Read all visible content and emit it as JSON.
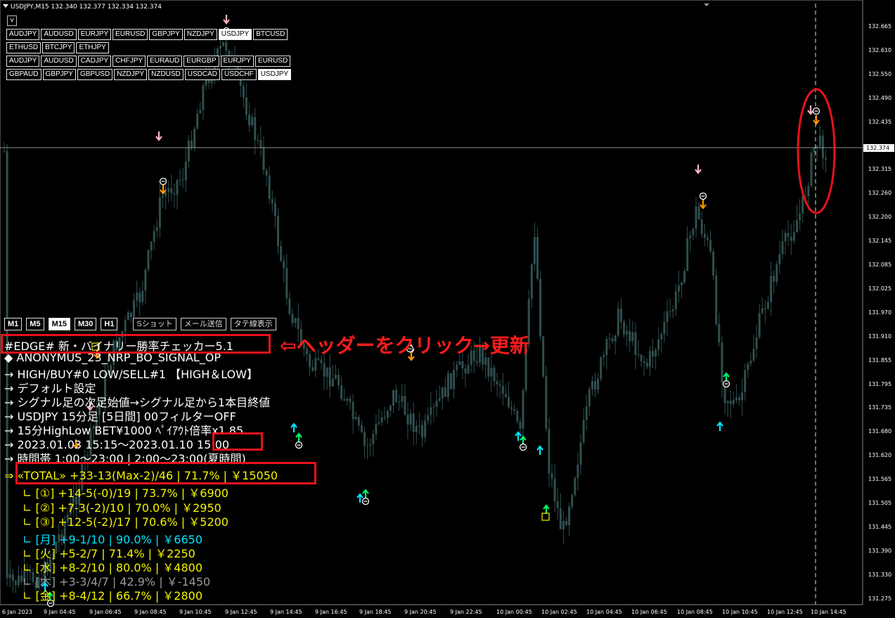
{
  "window": {
    "title": "USDJPY,M15  132.340 132.377 132.334 132.374",
    "v_label": "v"
  },
  "symbol_rows": [
    [
      "AUDJPY",
      "AUDUSD",
      "EURJPY",
      "EURUSD",
      "GBPJPY",
      "NZDJPY",
      "USDJPY",
      "BTCUSD"
    ],
    [
      "ETHUSD",
      "BTCJPY",
      "ETHJPY"
    ],
    [
      "AUDJPY",
      "AUDUSD",
      "CADJPY",
      "CHFJPY",
      "EURAUD",
      "EURGBP",
      "EURJPY",
      "EURUSD"
    ],
    [
      "GBPAUD",
      "GBPJPY",
      "GBPUSD",
      "NZDJPY",
      "NZDUSD",
      "USDCAD",
      "USDCHF",
      "USDJPY"
    ]
  ],
  "active_symbols": [
    [
      0,
      6
    ],
    [
      3,
      7
    ]
  ],
  "timeframes": [
    "M1",
    "M5",
    "M15",
    "M30",
    "H1"
  ],
  "active_timeframe": "M15",
  "tools": [
    "Sショット",
    "メール送信",
    "タテ線表示"
  ],
  "info": {
    "header": "#EDGE# 新・バイナリー勝率チェッカー5.1",
    "line1": "◆ ANONYMUS_23_NRP_BO_SIGNAL_OP",
    "line2": "→ HIGH/BUY#0  LOW/SELL#1   【HIGH＆LOW】",
    "line3": "→ デフォルト設定",
    "line4": "→ シグナル足の次足始値→シグナル足から1本目終値",
    "line5": "→ USDJPY    15分足   [5日間]   00フィルターOFF",
    "line6": "→ 15分HighLow   BET¥1000  ﾍﾟｲｱｳﾄ倍率x1.85",
    "line7": "→ 2023.01.03 15:15～2023.01.10 15:00",
    "line8": "→ 時間帯 1:00～23:00 | 2:00～23:00(夏時間)",
    "total": "⇒ «TOTAL» +33-13(Max-2)/46 | 71.7% | ￥15050",
    "sub1": "∟ [①] +14-5(-0)/19 | 73.7% | ￥6900",
    "sub2": "∟ [②] +7-3(-2)/10 | 70.0% | ￥2950",
    "sub3": "∟ [③] +12-5(-2)/17 | 70.6% | ￥5200",
    "day_mon": "∟ [月] +9-1/10 | 90.0% | ￥6650",
    "day_tue": "∟ [火] +5-2/7 | 71.4% | ￥2250",
    "day_wed": "∟ [水] +8-2/10 | 80.0% | ￥4800",
    "day_thu": "∟ [木] +3-3/4/7 | 42.9% | ￥-1450",
    "day_fri": "∟ [金] +8-4/12 | 66.7% | ￥2800"
  },
  "annotation": "⇦ヘッダーをクリック→更新",
  "y_axis": [
    "132.665",
    "132.610",
    "132.550",
    "132.490",
    "132.435",
    "132.374",
    "132.315",
    "132.260",
    "132.200",
    "132.145",
    "132.085",
    "132.025",
    "131.970",
    "131.910",
    "131.855",
    "131.795",
    "131.735",
    "131.680",
    "131.620",
    "131.565",
    "131.505",
    "131.445",
    "131.390",
    "131.330",
    "131.275"
  ],
  "current_price": "132.374",
  "x_axis": [
    "6 Jan 2023",
    "9 Jan 04:45",
    "9 Jan 06:45",
    "9 Jan 08:45",
    "9 Jan 10:45",
    "9 Jan 12:45",
    "9 Jan 14:45",
    "9 Jan 16:45",
    "9 Jan 18:45",
    "9 Jan 20:45",
    "9 Jan 22:45",
    "10 Jan 00:45",
    "10 Jan 02:45",
    "10 Jan 04:45",
    "10 Jan 06:45",
    "10 Jan 08:45",
    "10 Jan 10:45",
    "10 Jan 12:45",
    "10 Jan 14:45"
  ],
  "colors": {
    "candle": "#2f4f4f",
    "bull_arrow": "#00ff66",
    "bear_arrow": "#ff9900",
    "sell_pink": "#ffb6c1",
    "buy_cyan": "#00e5ff",
    "highlight": "#e8121c"
  }
}
